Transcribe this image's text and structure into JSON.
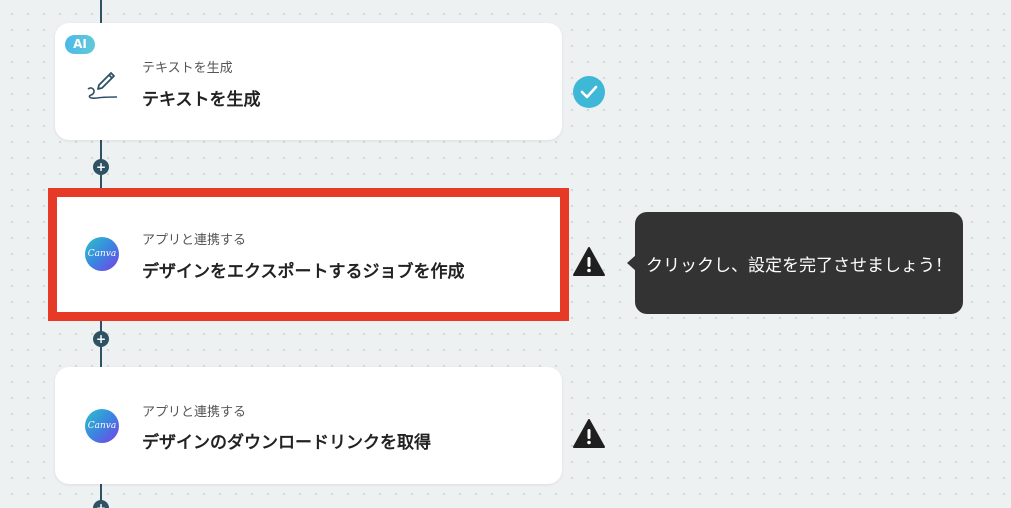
{
  "flow": {
    "steps": [
      {
        "badge": "AI",
        "icon": "pen-icon",
        "subtitle": "テキストを生成",
        "title": "テキストを生成",
        "status": "check-icon"
      },
      {
        "icon": "canva-logo",
        "logo_text": "Canva",
        "subtitle": "アプリと連携する",
        "title": "デザインをエクスポートするジョブを作成",
        "status": "warning-icon",
        "highlighted": true
      },
      {
        "icon": "canva-logo",
        "logo_text": "Canva",
        "subtitle": "アプリと連携する",
        "title": "デザインのダウンロードリンクを取得",
        "status": "warning-icon"
      }
    ],
    "add_step_symbol": "+",
    "tooltip": "クリックし、設定を完了させましょう！"
  },
  "colors": {
    "connector": "#2e5264",
    "highlight": "#e63a27",
    "success": "#3fb8d8",
    "tooltip_bg": "#333333"
  }
}
